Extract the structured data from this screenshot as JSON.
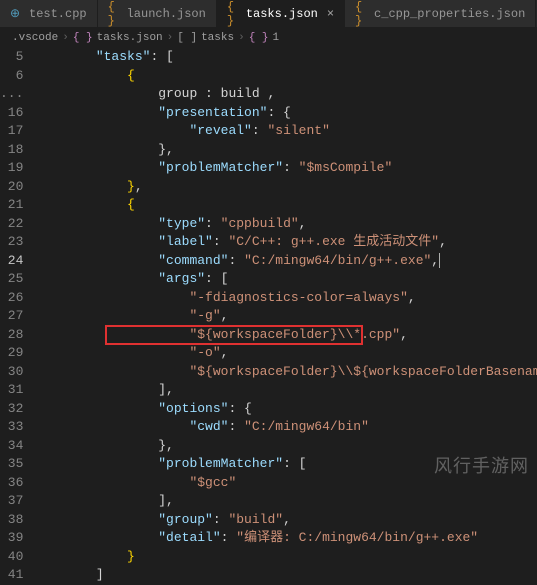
{
  "tabs": [
    {
      "label": "test.cpp",
      "icon": "cpp",
      "active": false
    },
    {
      "label": "launch.json",
      "icon": "json",
      "active": false
    },
    {
      "label": "tasks.json",
      "icon": "json",
      "active": true
    },
    {
      "label": "c_cpp_properties.json",
      "icon": "json",
      "active": false
    }
  ],
  "breadcrumb": {
    "folder": ".vscode",
    "file": "tasks.json",
    "path1": "tasks",
    "path2": "1"
  },
  "lines": [
    {
      "n": 5,
      "indent": 2,
      "k": "tasks",
      "after": ": ["
    },
    {
      "n": 6,
      "indent": 3,
      "raw_brace": "{"
    },
    {
      "n": "...",
      "indent": 4,
      "rawkey": "group",
      "rawval": "build",
      "trail": ","
    },
    {
      "n": 16,
      "indent": 4,
      "k": "presentation",
      "after": ": {"
    },
    {
      "n": 17,
      "indent": 5,
      "k": "reveal",
      "v": "silent"
    },
    {
      "n": 18,
      "indent": 4,
      "raw": "},"
    },
    {
      "n": 19,
      "indent": 4,
      "k": "problemMatcher",
      "v": "$msCompile"
    },
    {
      "n": 20,
      "indent": 3,
      "raw_b": "},"
    },
    {
      "n": 21,
      "indent": 3,
      "raw_brace": "{"
    },
    {
      "n": 22,
      "indent": 4,
      "k": "type",
      "v": "cppbuild",
      "trail": ","
    },
    {
      "n": 23,
      "indent": 4,
      "k": "label",
      "v": "C/C++: g++.exe 生成活动文件",
      "trail": ","
    },
    {
      "n": 24,
      "indent": 4,
      "k": "command",
      "v": "C:/mingw64/bin/g++.exe",
      "trail": ",",
      "cursor": true
    },
    {
      "n": 25,
      "indent": 4,
      "k": "args",
      "after": ": ["
    },
    {
      "n": 26,
      "indent": 5,
      "sv": "-fdiagnostics-color=always",
      "trail": ","
    },
    {
      "n": 27,
      "indent": 5,
      "sv": "-g",
      "trail": ","
    },
    {
      "n": 28,
      "indent": 5,
      "sv": "${workspaceFolder}\\\\*.cpp",
      "trail": ",",
      "highlight": true
    },
    {
      "n": 29,
      "indent": 5,
      "sv": "-o",
      "trail": ","
    },
    {
      "n": 30,
      "indent": 5,
      "sv": "${workspaceFolder}\\\\${workspaceFolderBasename}.exe"
    },
    {
      "n": 31,
      "indent": 4,
      "raw": "],"
    },
    {
      "n": 32,
      "indent": 4,
      "k": "options",
      "after": ": {"
    },
    {
      "n": 33,
      "indent": 5,
      "k": "cwd",
      "v": "C:/mingw64/bin"
    },
    {
      "n": 34,
      "indent": 4,
      "raw": "},"
    },
    {
      "n": 35,
      "indent": 4,
      "k": "problemMatcher",
      "after": ": ["
    },
    {
      "n": 36,
      "indent": 5,
      "sv": "$gcc"
    },
    {
      "n": 37,
      "indent": 4,
      "raw": "],"
    },
    {
      "n": 38,
      "indent": 4,
      "k": "group",
      "v": "build",
      "trail": ","
    },
    {
      "n": 39,
      "indent": 4,
      "k": "detail",
      "v": "编译器: C:/mingw64/bin/g++.exe"
    },
    {
      "n": 40,
      "indent": 3,
      "raw_b": "}"
    },
    {
      "n": 41,
      "indent": 2,
      "raw": "]"
    }
  ],
  "current_line": 24,
  "watermark": "风行手游网",
  "close_glyph": "×"
}
